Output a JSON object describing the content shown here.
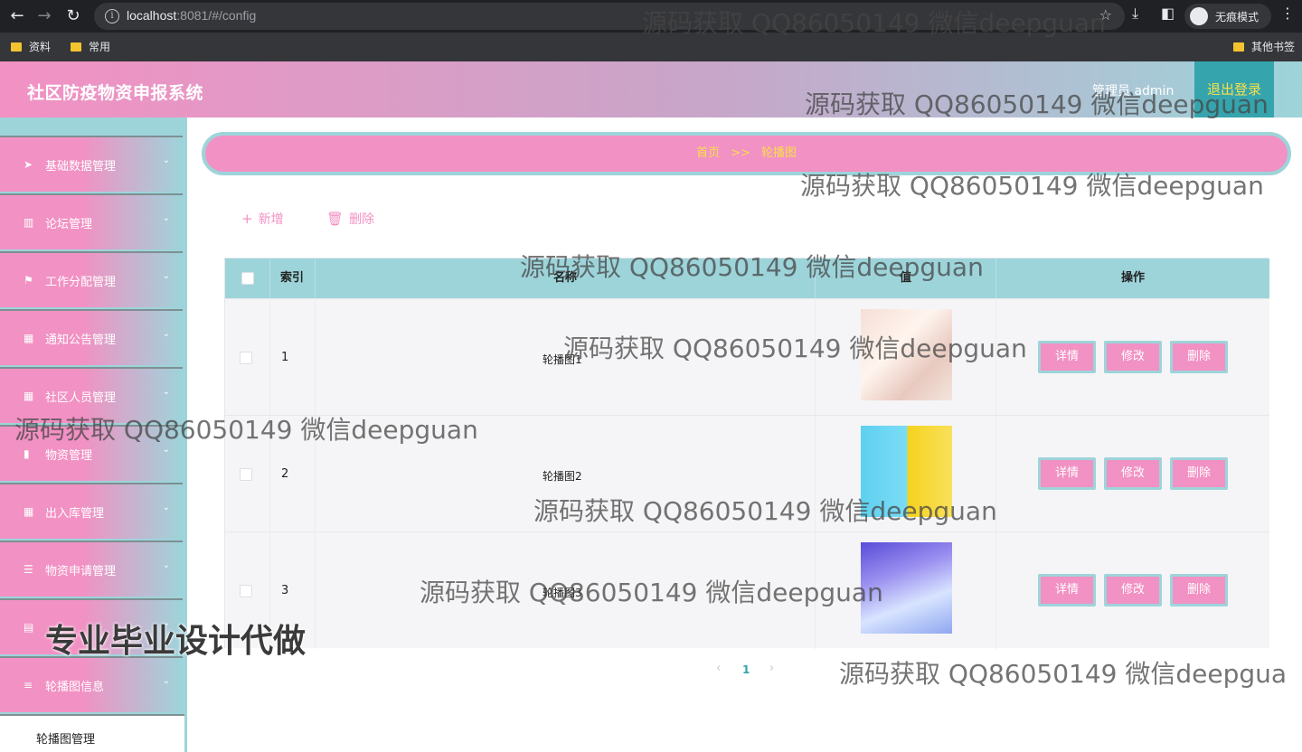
{
  "browser": {
    "url_host": "localhost",
    "url_rest": ":8081/#/config",
    "incognito_label": "无痕模式",
    "bookmarks": [
      "资料",
      "常用"
    ],
    "other_bookmarks": "其他书签"
  },
  "header": {
    "title": "社区防疫物资申报系统",
    "admin_label": "管理员 admin",
    "logout_label": "退出登录"
  },
  "sidebar": {
    "items": [
      {
        "label": "基础数据管理",
        "icon": "send-icon"
      },
      {
        "label": "论坛管理",
        "icon": "library-icon"
      },
      {
        "label": "工作分配管理",
        "icon": "flag-icon"
      },
      {
        "label": "通知公告管理",
        "icon": "grid-icon"
      },
      {
        "label": "社区人员管理",
        "icon": "grid-icon"
      },
      {
        "label": "物资管理",
        "icon": "bar-chart-icon"
      },
      {
        "label": "出入库管理",
        "icon": "grid-icon"
      },
      {
        "label": "物资申请管理",
        "icon": "sliders-icon"
      },
      {
        "label": "",
        "icon": "document-icon"
      },
      {
        "label": "轮播图信息",
        "icon": "list-icon"
      }
    ],
    "sub_item": "轮播图管理"
  },
  "breadcrumb": {
    "home": "首页",
    "separator": ">>",
    "current": "轮播图"
  },
  "toolbar": {
    "add_label": "新增",
    "delete_label": "删除"
  },
  "table": {
    "headers": {
      "index": "索引",
      "name": "名称",
      "value": "值",
      "actions": "操作"
    },
    "rows": [
      {
        "index": "1",
        "name": "轮播图1"
      },
      {
        "index": "2",
        "name": "轮播图2"
      },
      {
        "index": "3",
        "name": "轮播图3"
      }
    ],
    "actions": {
      "detail": "详情",
      "edit": "修改",
      "delete": "删除"
    }
  },
  "pagination": {
    "prev": "‹",
    "current": "1",
    "next": "›"
  },
  "watermarks": {
    "text": "源码获取 QQ86050149 微信deepguan",
    "text_cut": "源码获取 QQ86050149 微信deepgua",
    "big": "专业毕业设计代做"
  },
  "colors": {
    "pink": "#f291c3",
    "teal": "#9dd4da",
    "yellow": "#f7e04a"
  }
}
